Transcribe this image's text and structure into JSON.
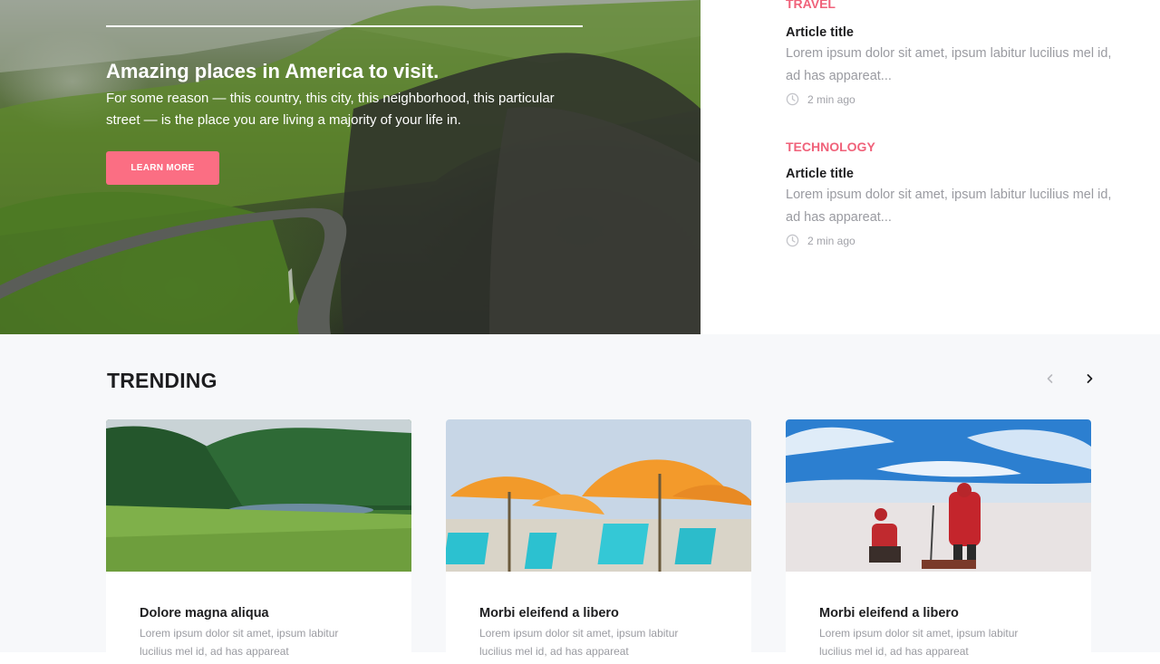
{
  "hero": {
    "title": "Amazing places in America to visit.",
    "description": "For some reason — this country, this city, this neighborhood, this particular street — is the place you are living a majority of your life in.",
    "button_label": "LEARN MORE",
    "accent_color": "#fb6e83"
  },
  "side_articles": [
    {
      "category": "TRAVEL",
      "title": "Article title",
      "excerpt": "Lorem ipsum dolor sit amet, ipsum labitur lucilius mel id, ad has appareat...",
      "time": "2 min ago",
      "icon": "clock-icon"
    },
    {
      "category": "TECHNOLOGY",
      "title": "Article title",
      "excerpt": "Lorem ipsum dolor sit amet, ipsum labitur lucilius mel id, ad has appareat...",
      "time": "2 min ago",
      "icon": "clock-icon"
    }
  ],
  "trending": {
    "heading": "TRENDING",
    "prev_icon": "chevron-left-icon",
    "next_icon": "chevron-right-icon",
    "cards": [
      {
        "title": "Dolore magna aliqua",
        "excerpt": "Lorem ipsum dolor sit amet, ipsum labitur lucilius mel id, ad has appareat",
        "image": "green-valley-lake-photo"
      },
      {
        "title": "Morbi eleifend a libero",
        "excerpt": "Lorem ipsum dolor sit amet, ipsum labitur lucilius mel id, ad has appareat",
        "image": "beach-umbrellas-photo"
      },
      {
        "title": "Morbi eleifend a libero",
        "excerpt": "Lorem ipsum dolor sit amet, ipsum labitur lucilius mel id, ad has appareat",
        "image": "snow-hikers-photo"
      }
    ]
  }
}
